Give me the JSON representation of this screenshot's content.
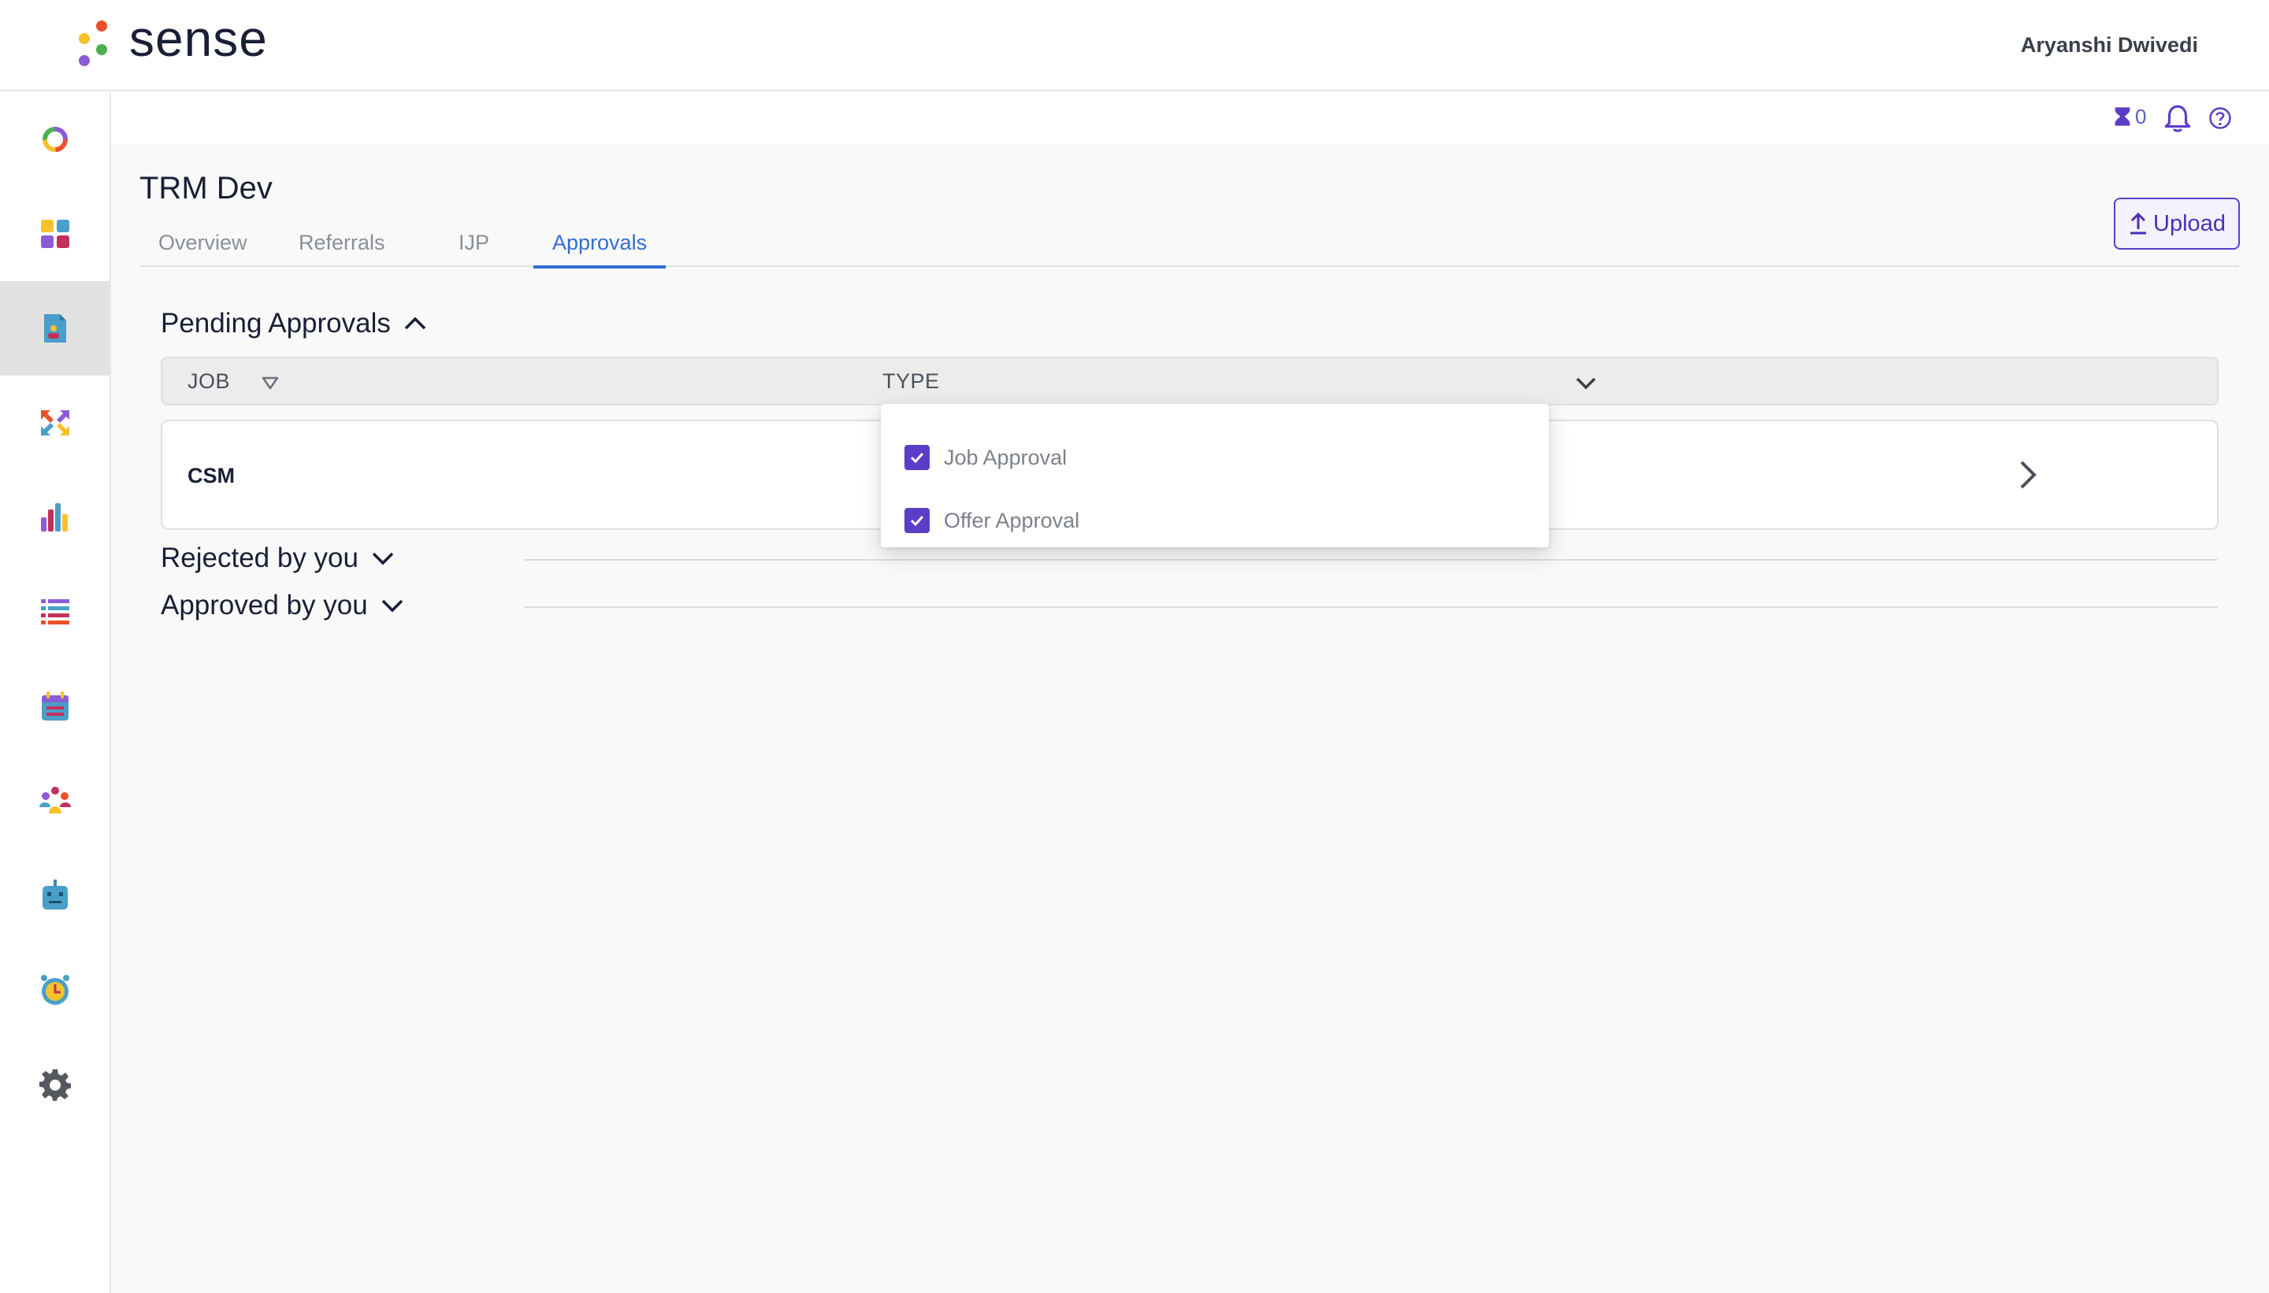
{
  "brand": {
    "name": "sense",
    "dot_colors": [
      "#e8512b",
      "#f5c22c",
      "#4caf50",
      "#8b5cd6"
    ]
  },
  "user": {
    "name": "Aryanshi Dwivedi"
  },
  "sidebar": {
    "items": [
      {
        "icon": "ring-chart-icon",
        "active": false
      },
      {
        "icon": "dashboard-grid-icon",
        "active": false
      },
      {
        "icon": "document-user-icon",
        "active": true
      },
      {
        "icon": "arrows-exchange-icon",
        "active": false
      },
      {
        "icon": "bar-chart-icon",
        "active": false
      },
      {
        "icon": "list-icon",
        "active": false
      },
      {
        "icon": "calendar-icon",
        "active": false
      },
      {
        "icon": "team-icon",
        "active": false
      },
      {
        "icon": "bot-icon",
        "active": false
      },
      {
        "icon": "alarm-clock-icon",
        "active": false
      },
      {
        "icon": "settings-gear-icon",
        "active": false
      }
    ]
  },
  "utility": {
    "hourglass_count": "0"
  },
  "page": {
    "title": "TRM Dev",
    "tabs": [
      {
        "label": "Overview",
        "active": false
      },
      {
        "label": "Referrals",
        "active": false
      },
      {
        "label": "IJP",
        "active": false
      },
      {
        "label": "Approvals",
        "active": true
      }
    ],
    "upload_label": "Upload"
  },
  "pending": {
    "title": "Pending Approvals",
    "columns": {
      "job": "JOB",
      "type": "TYPE"
    },
    "rows": [
      {
        "job": "CSM"
      }
    ]
  },
  "type_filter": {
    "options": [
      {
        "label": "Job Approval",
        "checked": true
      },
      {
        "label": "Offer Approval",
        "checked": true
      }
    ]
  },
  "rejected": {
    "title": "Rejected by you"
  },
  "approved": {
    "title": "Approved by you"
  },
  "colors": {
    "accent": "#5b3ec8",
    "tab_active": "#2f6fd1"
  }
}
